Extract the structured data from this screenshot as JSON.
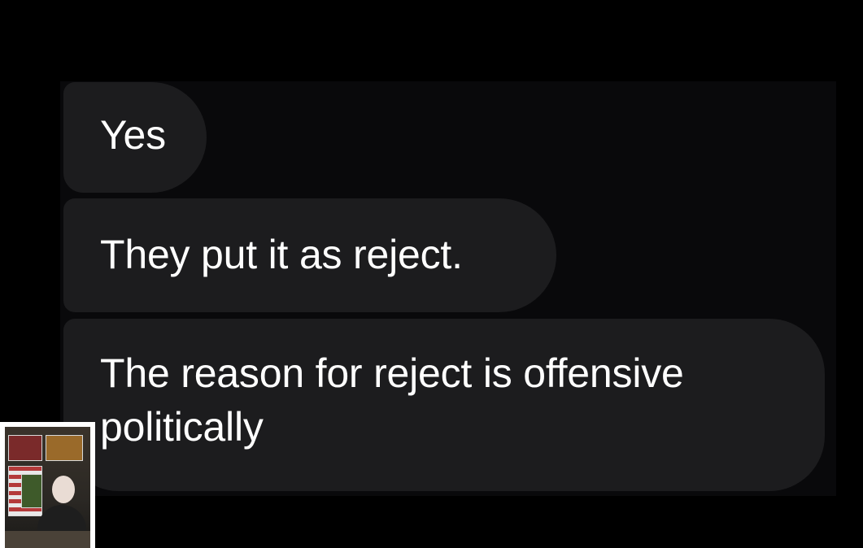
{
  "messages": [
    {
      "lines": [
        "Yes"
      ]
    },
    {
      "lines": [
        "They put it as reject."
      ]
    },
    {
      "lines": [
        "The reason for reject is offensive",
        "politically"
      ]
    }
  ],
  "colors": {
    "background": "#000000",
    "panel": "#09090b",
    "bubble": "#1c1c1e",
    "text": "#ffffff"
  }
}
